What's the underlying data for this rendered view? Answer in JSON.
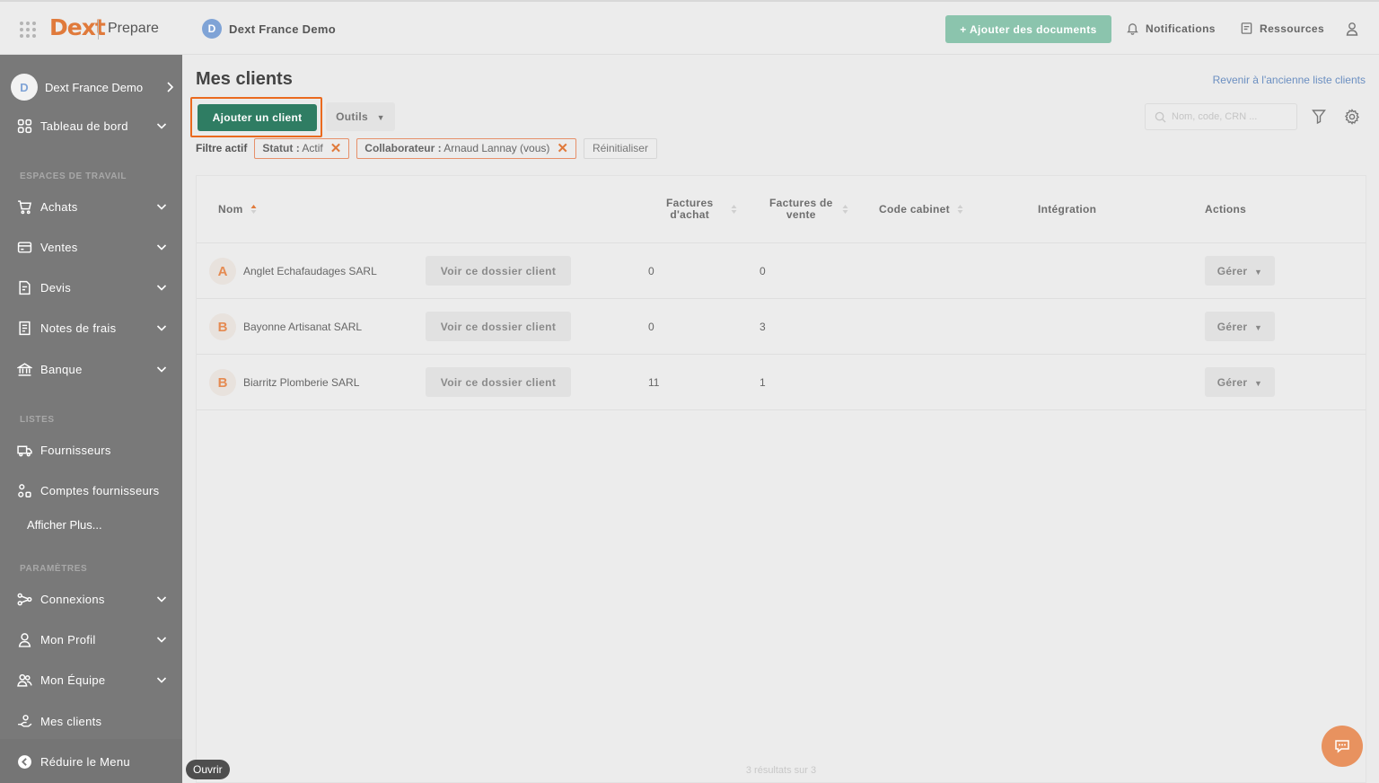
{
  "header": {
    "logo": "Dext",
    "product": "Prepare",
    "org_initial": "D",
    "org_name": "Dext France Demo",
    "add_documents": "+ Ajouter des documents",
    "notifications": "Notifications",
    "resources": "Ressources"
  },
  "sidebar": {
    "org_initial": "D",
    "org_name": "Dext France Demo",
    "dashboard": "Tableau de bord",
    "section_workspaces": "ESPACES DE TRAVAIL",
    "purchases": "Achats",
    "sales": "Ventes",
    "quotes": "Devis",
    "expenses": "Notes de frais",
    "bank": "Banque",
    "section_lists": "LISTES",
    "suppliers": "Fournisseurs",
    "supplier_accounts": "Comptes fournisseurs",
    "show_more": "Afficher Plus...",
    "section_settings": "PARAMÈTRES",
    "connections": "Connexions",
    "my_profile": "Mon Profil",
    "my_team": "Mon Équipe",
    "my_clients": "Mes clients",
    "collapse_menu": "Réduire le Menu"
  },
  "main": {
    "title": "Mes clients",
    "old_list_link": "Revenir à l'ancienne liste clients",
    "add_client": "Ajouter un client",
    "tools": "Outils",
    "search_placeholder": "Nom, code, CRN ...",
    "filter_label": "Filtre actif",
    "filter_status_key": "Statut :",
    "filter_status_value": "Actif",
    "filter_collab_key": "Collaborateur :",
    "filter_collab_value": "Arnaud Lannay (vous)",
    "reset": "Réinitialiser",
    "results": "3 résultats sur 3"
  },
  "table": {
    "col_name": "Nom",
    "col_purchase_l1": "Factures",
    "col_purchase_l2": "d'achat",
    "col_sales_l1": "Factures de",
    "col_sales_l2": "vente",
    "col_code": "Code cabinet",
    "col_integration": "Intégration",
    "col_actions": "Actions",
    "open_label": "Voir ce dossier client",
    "manage_label": "Gérer",
    "rows": [
      {
        "initial": "A",
        "name": "Anglet Echafaudages SARL",
        "purchases": "0",
        "sales": "0"
      },
      {
        "initial": "B",
        "name": "Bayonne Artisanat SARL",
        "purchases": "0",
        "sales": "3"
      },
      {
        "initial": "B",
        "name": "Biarritz Plomberie SARL",
        "purchases": "11",
        "sales": "1"
      }
    ]
  },
  "tooltip": "Ouvrir",
  "colors": {
    "brand_orange": "#e07a3b",
    "primary_green": "#2f7d63",
    "highlight": "#ea6a1f",
    "sidebar": "#797979"
  }
}
